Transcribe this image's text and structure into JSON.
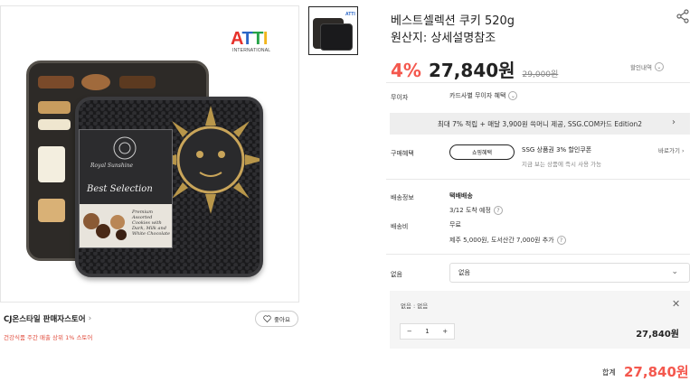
{
  "product_image": {
    "brand_logo_letters": [
      "A",
      "T",
      "T",
      "I"
    ],
    "brand_logo_sub": "INTERNATIONAL",
    "tin_script": "Royal Sunshine",
    "tin_title": "Best Selection",
    "tin_premium": "Premium Assorted Cookies with Dark, Milk and White Chocolate"
  },
  "store": {
    "name": "CJ온스타일 판매자스토어",
    "subtitle": "건강식품 주간 매출 상위 1% 스토어",
    "like_label": "좋아요"
  },
  "product": {
    "title": "베스트셀렉션 쿠키 520g",
    "origin": "원산지: 상세설명참조",
    "discount": "4%",
    "price": "27,840원",
    "original_price": "29,000원",
    "discount_detail": "할인내역"
  },
  "rows": {
    "interest_free_label": "무이자",
    "interest_free_value": "카드사별 무이자 혜택",
    "promo_banner": "최대 7% 적립 + 매달 3,900원 쓱머니 제공, SSG.COM카드 Edition2",
    "purchase_benefit_label": "구매혜택",
    "shopping_badge": "쇼핑혜택",
    "coupon_title": "SSG 상품권 3% 할인쿠폰",
    "coupon_sub": "지금 보는 상품에 즉시 사용 가능",
    "go_link": "바로가기",
    "delivery_label": "배송정보",
    "delivery_type": "택배배송",
    "delivery_eta": "3/12 도착 예정",
    "shipping_fee_label": "배송비",
    "shipping_fee_value": "무료",
    "shipping_fee_extra": "제주 5,000원, 도서산간 7,000원 추가"
  },
  "option": {
    "label": "없음",
    "selected": "없음",
    "selected_name": "없음 : 없음",
    "minus": "−",
    "quantity": "1",
    "plus": "+",
    "line_price": "27,840원"
  },
  "total": {
    "label": "합계",
    "price": "27,840원"
  },
  "colors": {
    "accent": "#f4584e",
    "banner_bg": "#eeeeee",
    "option_bg": "#f5f5f5"
  },
  "icons": [
    "share-icon",
    "info-icon",
    "chevron-right-icon",
    "chevron-down-icon",
    "heart-icon",
    "close-icon"
  ]
}
